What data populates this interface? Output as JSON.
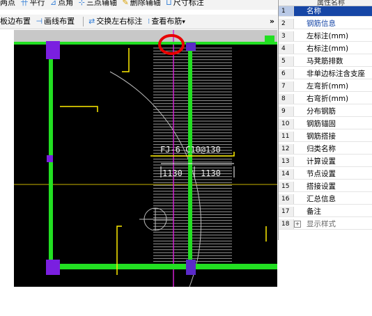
{
  "toolbar_top": {
    "items": [
      {
        "icon": "two-point-icon",
        "label": "两点"
      },
      {
        "icon": "parallel-icon",
        "label": "平行"
      },
      {
        "icon": "point-angle-icon",
        "label": "点角"
      },
      {
        "icon": "three-point-aux-icon",
        "label": "三点辅轴"
      },
      {
        "icon": "delete-aux-icon",
        "label": "删除辅轴"
      },
      {
        "icon": "dimension-icon",
        "label": "尺寸标注"
      }
    ]
  },
  "toolbar_second": {
    "items": [
      {
        "label": "板边布置"
      },
      {
        "icon": "line-layout-icon",
        "label": "画线布置"
      },
      {
        "icon": "swap-label-icon",
        "label": "交换左右标注"
      },
      {
        "icon": "view-rebar-icon",
        "label": "查看布筋"
      }
    ],
    "more": "»"
  },
  "canvas": {
    "rebar_label": "FJ-6 C10@130",
    "left_dim": "1130",
    "right_dim": "1130"
  },
  "property_panel": {
    "header": "属性名称",
    "rows": [
      {
        "no": "1",
        "label": "名称",
        "style": "sel"
      },
      {
        "no": "2",
        "label": "钢筋信息",
        "style": "blue"
      },
      {
        "no": "3",
        "label": "左标注(mm)",
        "style": ""
      },
      {
        "no": "4",
        "label": "右标注(mm)",
        "style": ""
      },
      {
        "no": "5",
        "label": "马凳筋排数",
        "style": ""
      },
      {
        "no": "6",
        "label": "非单边标注含支座",
        "style": ""
      },
      {
        "no": "7",
        "label": "左弯折(mm)",
        "style": ""
      },
      {
        "no": "8",
        "label": "右弯折(mm)",
        "style": ""
      },
      {
        "no": "9",
        "label": "分布钢筋",
        "style": ""
      },
      {
        "no": "10",
        "label": "钢筋锚固",
        "style": ""
      },
      {
        "no": "11",
        "label": "钢筋搭接",
        "style": ""
      },
      {
        "no": "12",
        "label": "归类名称",
        "style": ""
      },
      {
        "no": "13",
        "label": "计算设置",
        "style": ""
      },
      {
        "no": "14",
        "label": "节点设置",
        "style": ""
      },
      {
        "no": "15",
        "label": "搭接设置",
        "style": ""
      },
      {
        "no": "16",
        "label": "汇总信息",
        "style": ""
      },
      {
        "no": "17",
        "label": "备注",
        "style": ""
      },
      {
        "no": "18",
        "label": "显示样式",
        "style": "gray"
      }
    ]
  },
  "colors": {
    "beam_green": "#22e022",
    "column_purple": "#7a1fe0",
    "rebar_yellow": "#ffee00",
    "axis_magenta": "#d020d0",
    "highlight_red": "#e80000",
    "select_blue": "#1646a6"
  }
}
